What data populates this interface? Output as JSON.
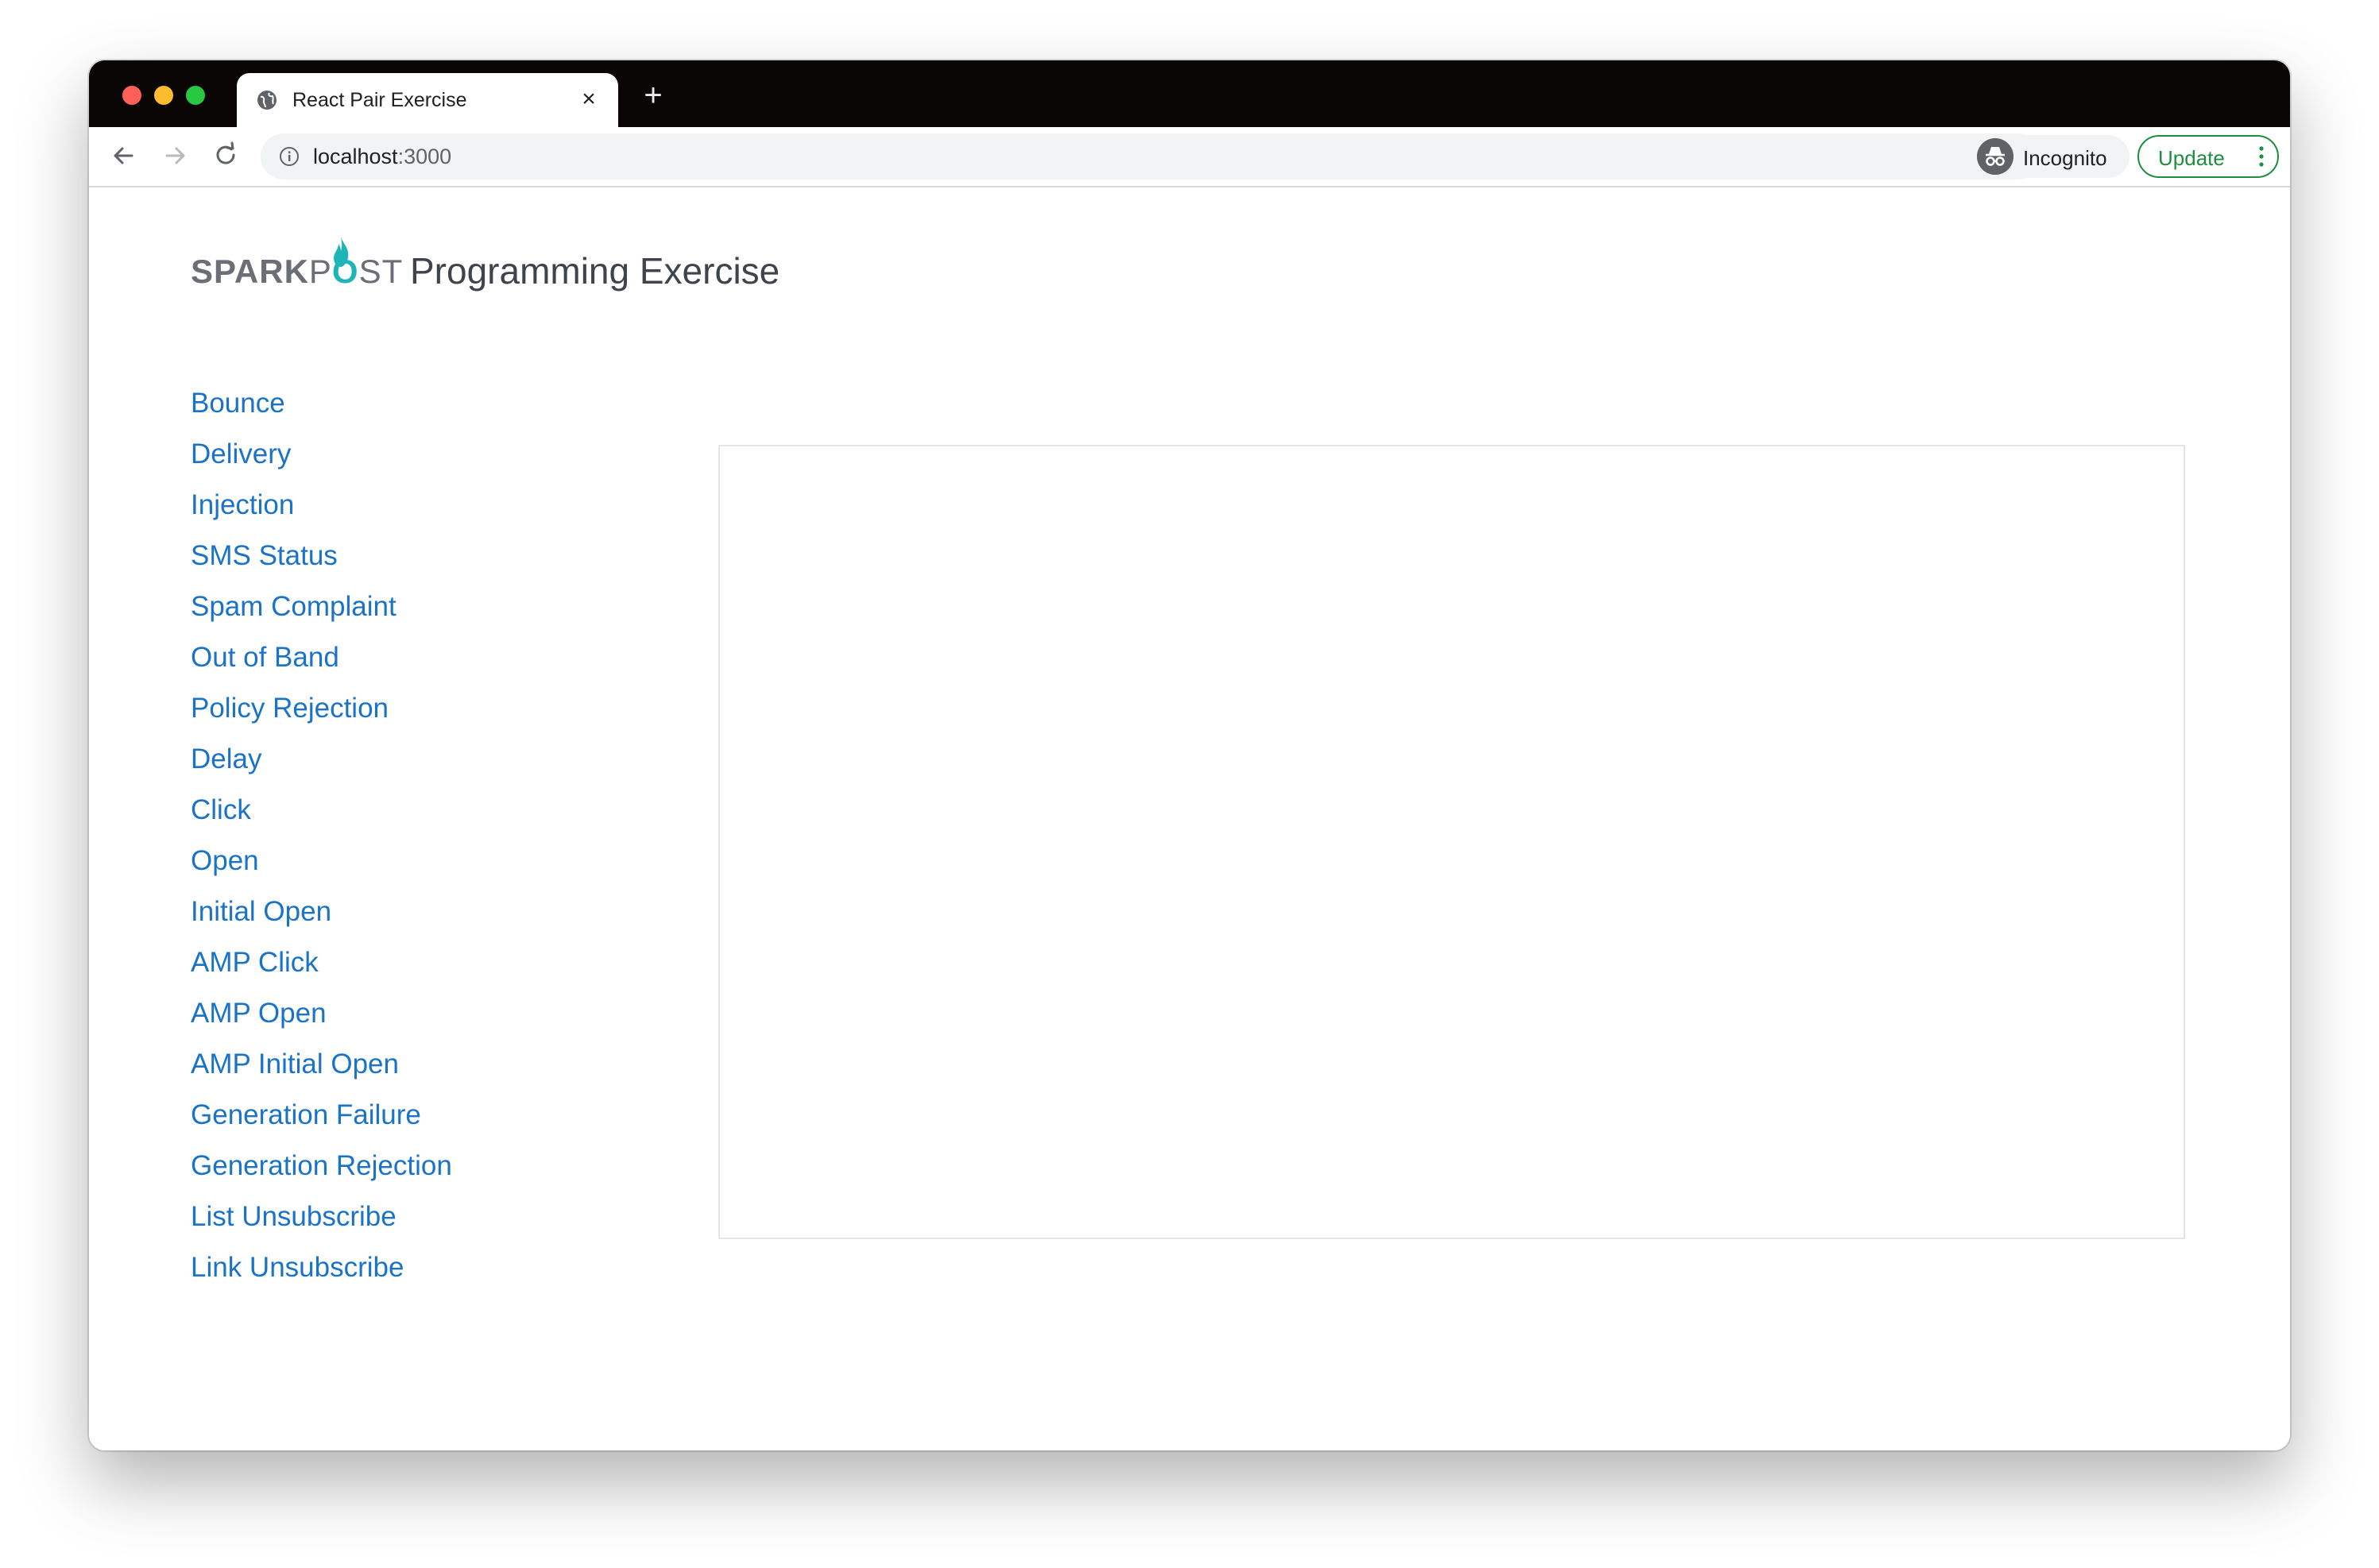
{
  "browser": {
    "tab": {
      "title": "React Pair Exercise",
      "close_icon": "close-icon",
      "favicon": "globe-icon"
    },
    "new_tab_label": "+",
    "address_bar": {
      "host": "localhost",
      "port": ":3000"
    },
    "incognito_label": "Incognito",
    "update_label": "Update"
  },
  "header": {
    "logo_left": "SPARK",
    "logo_p": "P",
    "logo_right": "ST",
    "title": "Programming Exercise"
  },
  "sidebar": {
    "items": [
      {
        "label": "Bounce"
      },
      {
        "label": "Delivery"
      },
      {
        "label": "Injection"
      },
      {
        "label": "SMS Status"
      },
      {
        "label": "Spam Complaint"
      },
      {
        "label": "Out of Band"
      },
      {
        "label": "Policy Rejection"
      },
      {
        "label": "Delay"
      },
      {
        "label": "Click"
      },
      {
        "label": "Open"
      },
      {
        "label": "Initial Open"
      },
      {
        "label": "AMP Click"
      },
      {
        "label": "AMP Open"
      },
      {
        "label": "AMP Initial Open"
      },
      {
        "label": "Generation Failure"
      },
      {
        "label": "Generation Rejection"
      },
      {
        "label": "List Unsubscribe"
      },
      {
        "label": "Link Unsubscribe"
      }
    ]
  },
  "colors": {
    "link": "#1a73c6",
    "brand_flame": "#1fb5b8",
    "update_green": "#1e8e3e"
  }
}
